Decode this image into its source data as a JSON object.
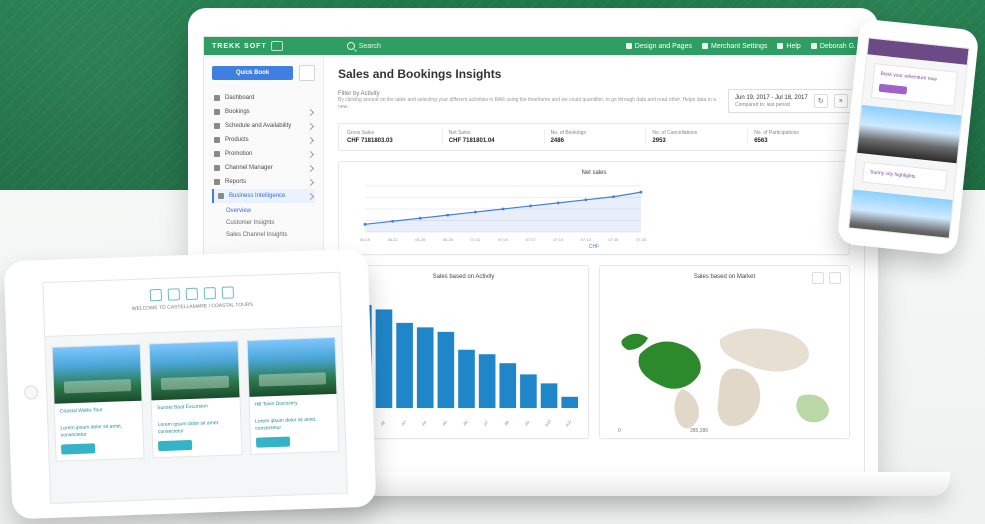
{
  "header": {
    "brand": "TREKK SOFT",
    "search_label": "Search",
    "right_items": [
      {
        "label": "Design and Pages"
      },
      {
        "label": "Merchant Settings"
      },
      {
        "label": "Help"
      },
      {
        "label": "Deborah G."
      }
    ]
  },
  "sidebar": {
    "quick_book_label": "Quick Book",
    "items": [
      {
        "label": "Dashboard"
      },
      {
        "label": "Bookings"
      },
      {
        "label": "Schedule and Availability"
      },
      {
        "label": "Products"
      },
      {
        "label": "Promotion"
      },
      {
        "label": "Channel Manager"
      },
      {
        "label": "Reports"
      },
      {
        "label": "Business Intelligence"
      }
    ],
    "subitems": [
      {
        "label": "Overview"
      },
      {
        "label": "Customer Insights"
      },
      {
        "label": "Sales Channel Insights"
      }
    ]
  },
  "main": {
    "title": "Sales and Bookings Insights",
    "filter_label": "Filter by Activity",
    "filter_desc": "By clicking around on the table and selecting your different activities in BAR using the timeframe and we could quantifier, to go through data and read other. Helps data in a new.",
    "date_range": "Jun 19, 2017 - Jul 18, 2017",
    "date_sub": "Compared to: last period",
    "kpis": [
      {
        "label": "Gross Sales",
        "value": "CHF 7181803.03"
      },
      {
        "label": "Net Sales",
        "value": "CHF 7181801.04"
      },
      {
        "label": "No. of Bookings",
        "value": "2486"
      },
      {
        "label": "No. of Cancellations",
        "value": "2953"
      },
      {
        "label": "No. of Participations",
        "value": "6563"
      }
    ],
    "net_sales": {
      "title": "Net sales",
      "legend": "CHF",
      "chart_data": {
        "type": "area",
        "x": [
          "06.19",
          "06.22",
          "06.25",
          "06.28",
          "07.01",
          "07.04",
          "07.07",
          "07.10",
          "07.13",
          "07.16",
          "07.18"
        ],
        "series": [
          {
            "name": "CHF",
            "values": [
              5000,
              7000,
              9000,
              11000,
              13000,
              15000,
              17000,
              19000,
              21000,
              23000,
              26000
            ]
          }
        ],
        "ylabel": "",
        "ylim": [
          0,
          30000
        ]
      }
    },
    "activity": {
      "title": "Sales based on Activity",
      "chart_data": {
        "type": "bar",
        "categories": [
          "A1",
          "A2",
          "A3",
          "A4",
          "A5",
          "A6",
          "A7",
          "A8",
          "A9",
          "A10",
          "A11"
        ],
        "values": [
          92,
          88,
          76,
          72,
          68,
          52,
          48,
          40,
          30,
          22,
          10
        ],
        "ylim": [
          0,
          100
        ]
      }
    },
    "market": {
      "title": "Sales based on Market",
      "legend_min": "0",
      "legend_max": "285,286"
    }
  },
  "tablet": {
    "caption": "WELCOME TO CASTELLAMARE / COASTAL TOURS",
    "cards": [
      {
        "title": "Coastal Walks Tour",
        "text": "Lorem ipsum dolor sit amet, consectetur"
      },
      {
        "title": "Sunset Boat Excursion",
        "text": "Lorem ipsum dolor sit amet, consectetur"
      },
      {
        "title": "Hill Town Discovery",
        "text": "Lorem ipsum dolor sit amet, consectetur"
      }
    ]
  },
  "phone": {
    "card_text": "Book your adventure now",
    "sub_text": "Sunny city highlights"
  }
}
